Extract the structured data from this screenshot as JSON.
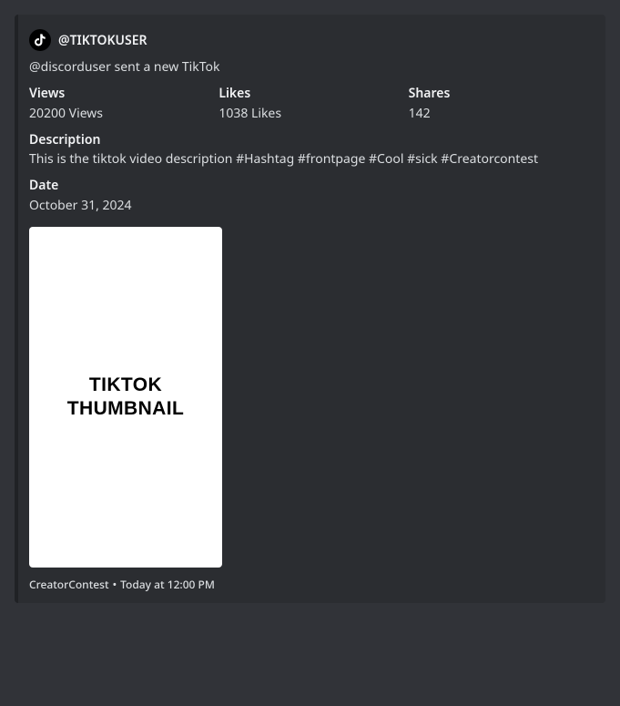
{
  "author": {
    "name": "@TIKTOKUSER"
  },
  "description": "@discorduser sent a new TikTok",
  "fields": {
    "views": {
      "name": "Views",
      "value": "20200 Views"
    },
    "likes": {
      "name": "Likes",
      "value": "1038 Likes"
    },
    "shares": {
      "name": "Shares",
      "value": "142"
    },
    "desc": {
      "name": "Description",
      "value": "This is the tiktok video description #Hashtag #frontpage #Cool #sick #Creatorcontest"
    },
    "date": {
      "name": "Date",
      "value": "October 31, 2024"
    }
  },
  "thumbnail": {
    "line1": "TIKTOK",
    "line2": "THUMBNAIL"
  },
  "footer": {
    "text": "CreatorContest",
    "separator": "•",
    "timestamp": "Today at 12:00 PM"
  }
}
